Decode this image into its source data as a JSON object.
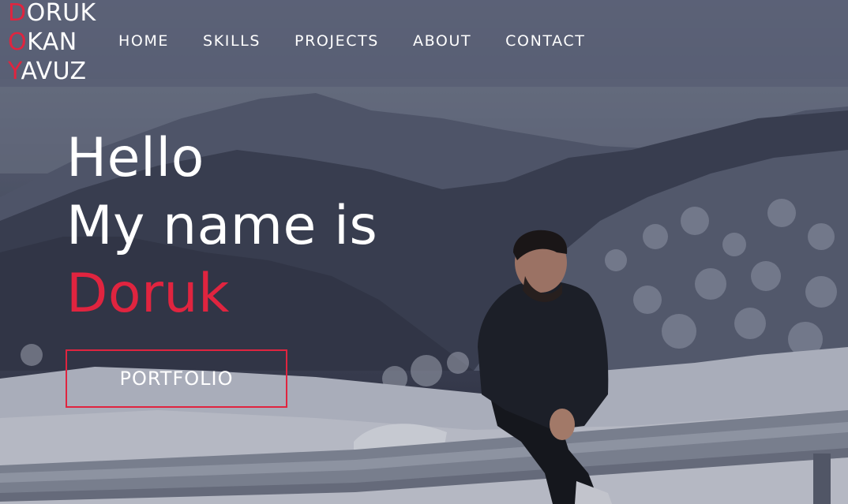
{
  "logo": {
    "lines": [
      {
        "initial": "D",
        "rest": "ORUK"
      },
      {
        "initial": "O",
        "rest": "KAN"
      },
      {
        "initial": "Y",
        "rest": "AVUZ"
      }
    ]
  },
  "nav": {
    "items": [
      "HOME",
      "SKILLS",
      "PROJECTS",
      "ABOUT",
      "CONTACT"
    ]
  },
  "hero": {
    "line1": "Hello",
    "line2": "My name is",
    "name": "Doruk",
    "button_label": "PORTFOLIO"
  },
  "colors": {
    "accent": "#e0243f",
    "text": "#ffffff",
    "header_bg": "#585e74"
  }
}
